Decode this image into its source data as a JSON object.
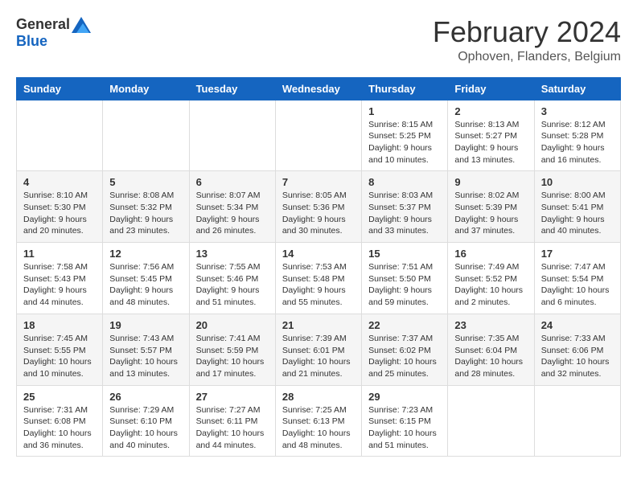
{
  "logo": {
    "general": "General",
    "blue": "Blue"
  },
  "title": {
    "month_year": "February 2024",
    "location": "Ophoven, Flanders, Belgium"
  },
  "weekdays": [
    "Sunday",
    "Monday",
    "Tuesday",
    "Wednesday",
    "Thursday",
    "Friday",
    "Saturday"
  ],
  "weeks": [
    [
      {
        "day": "",
        "info": ""
      },
      {
        "day": "",
        "info": ""
      },
      {
        "day": "",
        "info": ""
      },
      {
        "day": "",
        "info": ""
      },
      {
        "day": "1",
        "info": "Sunrise: 8:15 AM\nSunset: 5:25 PM\nDaylight: 9 hours\nand 10 minutes."
      },
      {
        "day": "2",
        "info": "Sunrise: 8:13 AM\nSunset: 5:27 PM\nDaylight: 9 hours\nand 13 minutes."
      },
      {
        "day": "3",
        "info": "Sunrise: 8:12 AM\nSunset: 5:28 PM\nDaylight: 9 hours\nand 16 minutes."
      }
    ],
    [
      {
        "day": "4",
        "info": "Sunrise: 8:10 AM\nSunset: 5:30 PM\nDaylight: 9 hours\nand 20 minutes."
      },
      {
        "day": "5",
        "info": "Sunrise: 8:08 AM\nSunset: 5:32 PM\nDaylight: 9 hours\nand 23 minutes."
      },
      {
        "day": "6",
        "info": "Sunrise: 8:07 AM\nSunset: 5:34 PM\nDaylight: 9 hours\nand 26 minutes."
      },
      {
        "day": "7",
        "info": "Sunrise: 8:05 AM\nSunset: 5:36 PM\nDaylight: 9 hours\nand 30 minutes."
      },
      {
        "day": "8",
        "info": "Sunrise: 8:03 AM\nSunset: 5:37 PM\nDaylight: 9 hours\nand 33 minutes."
      },
      {
        "day": "9",
        "info": "Sunrise: 8:02 AM\nSunset: 5:39 PM\nDaylight: 9 hours\nand 37 minutes."
      },
      {
        "day": "10",
        "info": "Sunrise: 8:00 AM\nSunset: 5:41 PM\nDaylight: 9 hours\nand 40 minutes."
      }
    ],
    [
      {
        "day": "11",
        "info": "Sunrise: 7:58 AM\nSunset: 5:43 PM\nDaylight: 9 hours\nand 44 minutes."
      },
      {
        "day": "12",
        "info": "Sunrise: 7:56 AM\nSunset: 5:45 PM\nDaylight: 9 hours\nand 48 minutes."
      },
      {
        "day": "13",
        "info": "Sunrise: 7:55 AM\nSunset: 5:46 PM\nDaylight: 9 hours\nand 51 minutes."
      },
      {
        "day": "14",
        "info": "Sunrise: 7:53 AM\nSunset: 5:48 PM\nDaylight: 9 hours\nand 55 minutes."
      },
      {
        "day": "15",
        "info": "Sunrise: 7:51 AM\nSunset: 5:50 PM\nDaylight: 9 hours\nand 59 minutes."
      },
      {
        "day": "16",
        "info": "Sunrise: 7:49 AM\nSunset: 5:52 PM\nDaylight: 10 hours\nand 2 minutes."
      },
      {
        "day": "17",
        "info": "Sunrise: 7:47 AM\nSunset: 5:54 PM\nDaylight: 10 hours\nand 6 minutes."
      }
    ],
    [
      {
        "day": "18",
        "info": "Sunrise: 7:45 AM\nSunset: 5:55 PM\nDaylight: 10 hours\nand 10 minutes."
      },
      {
        "day": "19",
        "info": "Sunrise: 7:43 AM\nSunset: 5:57 PM\nDaylight: 10 hours\nand 13 minutes."
      },
      {
        "day": "20",
        "info": "Sunrise: 7:41 AM\nSunset: 5:59 PM\nDaylight: 10 hours\nand 17 minutes."
      },
      {
        "day": "21",
        "info": "Sunrise: 7:39 AM\nSunset: 6:01 PM\nDaylight: 10 hours\nand 21 minutes."
      },
      {
        "day": "22",
        "info": "Sunrise: 7:37 AM\nSunset: 6:02 PM\nDaylight: 10 hours\nand 25 minutes."
      },
      {
        "day": "23",
        "info": "Sunrise: 7:35 AM\nSunset: 6:04 PM\nDaylight: 10 hours\nand 28 minutes."
      },
      {
        "day": "24",
        "info": "Sunrise: 7:33 AM\nSunset: 6:06 PM\nDaylight: 10 hours\nand 32 minutes."
      }
    ],
    [
      {
        "day": "25",
        "info": "Sunrise: 7:31 AM\nSunset: 6:08 PM\nDaylight: 10 hours\nand 36 minutes."
      },
      {
        "day": "26",
        "info": "Sunrise: 7:29 AM\nSunset: 6:10 PM\nDaylight: 10 hours\nand 40 minutes."
      },
      {
        "day": "27",
        "info": "Sunrise: 7:27 AM\nSunset: 6:11 PM\nDaylight: 10 hours\nand 44 minutes."
      },
      {
        "day": "28",
        "info": "Sunrise: 7:25 AM\nSunset: 6:13 PM\nDaylight: 10 hours\nand 48 minutes."
      },
      {
        "day": "29",
        "info": "Sunrise: 7:23 AM\nSunset: 6:15 PM\nDaylight: 10 hours\nand 51 minutes."
      },
      {
        "day": "",
        "info": ""
      },
      {
        "day": "",
        "info": ""
      }
    ]
  ]
}
